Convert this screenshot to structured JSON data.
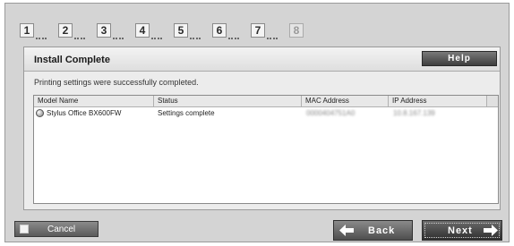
{
  "steps": [
    {
      "number": "1",
      "enabled": true
    },
    {
      "number": "2",
      "enabled": true
    },
    {
      "number": "3",
      "enabled": true
    },
    {
      "number": "4",
      "enabled": true
    },
    {
      "number": "5",
      "enabled": true
    },
    {
      "number": "6",
      "enabled": true
    },
    {
      "number": "7",
      "enabled": true
    },
    {
      "number": "8",
      "enabled": false
    }
  ],
  "panel": {
    "title": "Install Complete",
    "help_label": "Help",
    "message": "Printing settings were successfully completed."
  },
  "table": {
    "columns": [
      "Model Name",
      "Status",
      "MAC Address",
      "IP Address"
    ],
    "rows": [
      {
        "model": "Stylus Office BX600FW",
        "status": "Settings complete",
        "mac": "0000404751A0",
        "ip": "10.8.167.139"
      }
    ]
  },
  "buttons": {
    "cancel_label": "Cancel",
    "back_label": "Back",
    "next_label": "Next"
  },
  "icons": {
    "printer": "printer-icon",
    "back": "arrow-left-icon",
    "next": "arrow-right-icon"
  }
}
